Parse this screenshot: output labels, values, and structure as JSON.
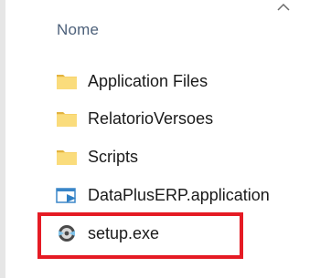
{
  "header": {
    "column_name_label": "Nome"
  },
  "files": [
    {
      "name": "Application Files",
      "icon": "folder-icon",
      "type": "folder"
    },
    {
      "name": "RelatorioVersoes",
      "icon": "folder-icon",
      "type": "folder"
    },
    {
      "name": "Scripts",
      "icon": "folder-icon",
      "type": "folder"
    },
    {
      "name": "DataPlusERP.application",
      "icon": "application-manifest-icon",
      "type": "application"
    },
    {
      "name": "setup.exe",
      "icon": "setup-exe-icon",
      "type": "exe",
      "highlighted": true
    }
  ],
  "colors": {
    "folder_yellow": "#f7d26a",
    "folder_dark": "#e2b33f",
    "highlight_red": "#e51b24",
    "header_text": "#4c607a"
  }
}
